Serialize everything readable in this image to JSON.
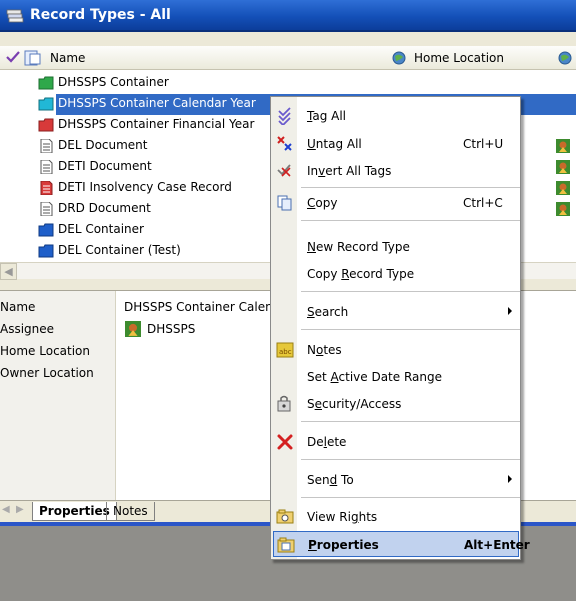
{
  "window": {
    "title": "Record Types - All"
  },
  "columns": {
    "name": "Name",
    "home_location": "Home Location"
  },
  "tree": {
    "rows": [
      {
        "label": "DHSSPS Container",
        "icon": "green-folder-icon"
      },
      {
        "label": "DHSSPS Container Calendar Year",
        "icon": "cyan-folder-icon"
      },
      {
        "label": "DHSSPS Container Financial Year",
        "icon": "red-folder-icon"
      },
      {
        "label": "DEL Document",
        "icon": "document-icon"
      },
      {
        "label": "DETI Document",
        "icon": "document-icon"
      },
      {
        "label": "DETI Insolvency Case Record",
        "icon": "red-document-icon"
      },
      {
        "label": "DRD Document",
        "icon": "document-icon"
      },
      {
        "label": "DEL Container",
        "icon": "blue-folder-icon"
      },
      {
        "label": "DEL Container (Test)",
        "icon": "blue-folder-icon"
      }
    ]
  },
  "details": {
    "name_label": "Name",
    "name_value": "DHSSPS Container Calen",
    "assignee_label": "Assignee",
    "assignee_value": "DHSSPS",
    "home_location_label": "Home Location",
    "owner_location_label": "Owner Location"
  },
  "tabs": {
    "properties": "Properties",
    "notes": "Notes"
  },
  "context_menu": {
    "tag_all_pre": "",
    "tag_all_key": "T",
    "tag_all_post": "ag All",
    "untag_all_pre": "",
    "untag_all_key": "U",
    "untag_all_post": "ntag All",
    "untag_all_shortcut": "Ctrl+U",
    "invert_pre": "In",
    "invert_key": "v",
    "invert_post": "ert All Tags",
    "copy_pre": "",
    "copy_key": "C",
    "copy_post": "opy",
    "copy_shortcut": "Ctrl+C",
    "new_pre": "",
    "new_key": "N",
    "new_post": "ew Record Type",
    "copyrt_pre": "Copy ",
    "copyrt_key": "R",
    "copyrt_post": "ecord Type",
    "search_pre": "",
    "search_key": "S",
    "search_post": "earch",
    "notes_pre": "N",
    "notes_key": "o",
    "notes_post": "tes",
    "date_pre": "Set ",
    "date_key": "A",
    "date_post": "ctive Date Range",
    "security_pre": "S",
    "security_key": "e",
    "security_post": "curity/Access",
    "delete_pre": "De",
    "delete_key": "l",
    "delete_post": "ete",
    "sendto_pre": "Sen",
    "sendto_key": "d",
    "sendto_post": " To",
    "viewrights_pre": "View Ri",
    "viewrights_key": "g",
    "viewrights_post": "hts",
    "properties_pre": "",
    "properties_key": "P",
    "properties_post": "roperties",
    "properties_shortcut": "Alt+Enter"
  },
  "colors": {
    "titlebar": "#1450b8",
    "selection": "#316ac5",
    "menu_highlight": "#c1d2ee"
  }
}
